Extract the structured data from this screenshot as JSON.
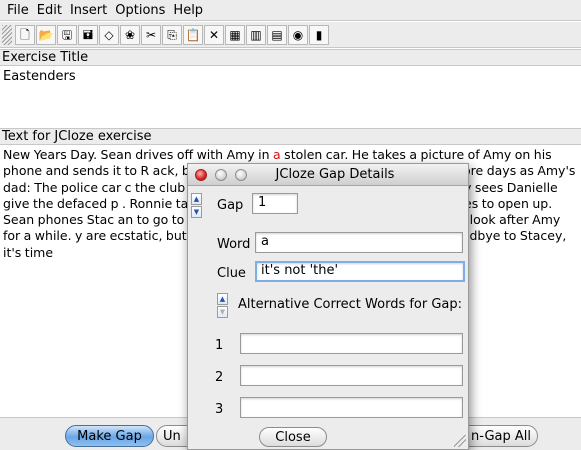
{
  "menu": [
    "File",
    "Edit",
    "Insert",
    "Options",
    "Help"
  ],
  "toolbar_icons": [
    {
      "name": "new-file-icon",
      "glyph": "🗋"
    },
    {
      "name": "open-folder-icon",
      "glyph": "📂"
    },
    {
      "name": "save-icon",
      "glyph": "🖫"
    },
    {
      "name": "save-as-icon",
      "glyph": "🖬"
    },
    {
      "name": "eraser-icon",
      "glyph": "◇"
    },
    {
      "name": "options-icon",
      "glyph": "❀"
    },
    {
      "name": "cut-icon",
      "glyph": "✂"
    },
    {
      "name": "copy-icon",
      "glyph": "⎘"
    },
    {
      "name": "paste-icon",
      "glyph": "📋"
    },
    {
      "name": "delete-icon",
      "glyph": "✕"
    },
    {
      "name": "exercise-icon",
      "glyph": "▦"
    },
    {
      "name": "export-web-icon",
      "glyph": "▥"
    },
    {
      "name": "export-drag-icon",
      "glyph": "▤"
    },
    {
      "name": "add-reading-icon",
      "glyph": "◉"
    },
    {
      "name": "book-icon",
      "glyph": "▮"
    }
  ],
  "exercise_title": {
    "label": "Exercise Title",
    "value": "Eastenders"
  },
  "exercise_text": {
    "label": "Text for JCloze exercise",
    "segments": [
      {
        "text": "New Years Day. Sean drives off with Amy in ",
        "gap": false
      },
      {
        "text": "a",
        "gap": true
      },
      {
        "text": "  stolen car. He takes a picture of Amy on his phone and sends it to R",
        "gap": false
      },
      {
        "text": "                                           ",
        "gap": false
      },
      {
        "text": "ack, but he says he doesn't know how. A po",
        "gap": false
      },
      {
        "text": "                                          ",
        "gap": false
      },
      {
        "text": "few more days as Amy's dad: The police car c",
        "gap": false
      },
      {
        "text": "                                        ",
        "gap": false
      },
      {
        "text": "the club to her. Jack refuses, he still thinks",
        "gap": false
      },
      {
        "text": "                                        ",
        "gap": false
      },
      {
        "text": "ees. Stacey sees Danielle give the defaced p",
        "gap": false
      },
      {
        "text": "                                        ",
        "gap": false
      },
      {
        "text": ". Ronnie takes a photo to Peggy and fearing",
        "gap": false
      },
      {
        "text": "                                        ",
        "gap": false
      },
      {
        "text": "eggy decides to open up. Sean phones Stac",
        "gap": false
      },
      {
        "text": "                                        ",
        "gap": false
      },
      {
        "text": "an to go to the police and explain why he",
        "gap": false
      },
      {
        "text": "                                        ",
        "gap": false
      },
      {
        "text": "asks Stacey to look after Amy for a while.",
        "gap": false
      },
      {
        "text": "                                        ",
        "gap": false
      },
      {
        "text": "y are ecstatic, but Stacey feels guilty for betra",
        "gap": false
      },
      {
        "text": "                                        ",
        "gap": false
      },
      {
        "text": "ays a tearful goodbye to Stacey, it's time",
        "gap": false
      }
    ]
  },
  "bottom_buttons": {
    "make_gap": "Make Gap",
    "un": "Un",
    "gap_all": "n-Gap All"
  },
  "dialog": {
    "title": "JCloze Gap Details",
    "gap_label": "Gap",
    "gap_value": "1",
    "word_label": "Word",
    "word_value": "a",
    "clue_label": "Clue",
    "clue_value": "it's not 'the'",
    "alt_label": "Alternative Correct Words for Gap:",
    "alt_rows": [
      {
        "num": "1",
        "value": ""
      },
      {
        "num": "2",
        "value": ""
      },
      {
        "num": "3",
        "value": ""
      }
    ],
    "close_label": "Close"
  },
  "colors": {
    "gap_highlight": "#d4141c",
    "focus_ring": "#7eaee8",
    "default_button": "#6aa6e6"
  }
}
